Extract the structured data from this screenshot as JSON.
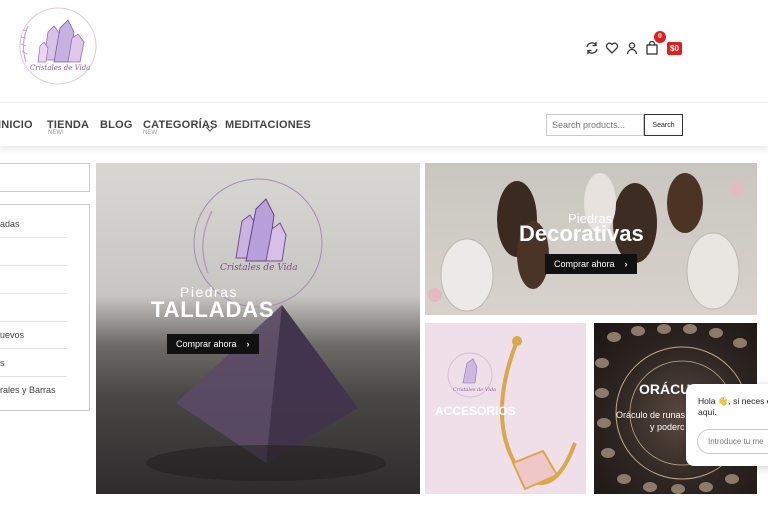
{
  "brand": {
    "logo_text": "Cristales de Vida"
  },
  "header": {
    "icons": [
      "refresh-icon",
      "heart-icon",
      "user-icon",
      "bag-icon"
    ],
    "cart_count": "0",
    "cart_total": "$0"
  },
  "nav": {
    "items": [
      {
        "label": "INICIO",
        "sub": ""
      },
      {
        "label": "TIENDA",
        "sub": "NEW!"
      },
      {
        "label": "BLOG",
        "sub": ""
      },
      {
        "label": "CATEGORÍAS",
        "sub": "NEW"
      },
      {
        "label": "MEDITACIONES",
        "sub": ""
      }
    ],
    "search": {
      "placeholder": "Search products...",
      "button": "Search"
    }
  },
  "sidebar": {
    "items": [
      {
        "label": "adas"
      },
      {
        "label": ""
      },
      {
        "label": ""
      },
      {
        "label": "uevos"
      },
      {
        "label": "s"
      },
      {
        "label": "rales y Barras"
      }
    ]
  },
  "banners": {
    "tallada": {
      "top": "Piedras",
      "main": "TALLADAS",
      "button": "Comprar ahora",
      "logo_text": "Cristales de Vida"
    },
    "decorativas": {
      "top": "Piedras",
      "main": "Decorativas",
      "button": "Comprar ahora"
    },
    "accesorios": {
      "main": "ACCESORIOS",
      "logo_text": "Cristales de Vida"
    },
    "oraculos": {
      "main": "ORÁCU",
      "line1": "Oráculo de runas",
      "line2": "y poderc"
    }
  },
  "chat": {
    "message": "Hola 👋, si neces estoy aquí.",
    "placeholder": "Introduce tu me"
  },
  "colors": {
    "accent": "#e21f1f",
    "button": "#111111"
  }
}
